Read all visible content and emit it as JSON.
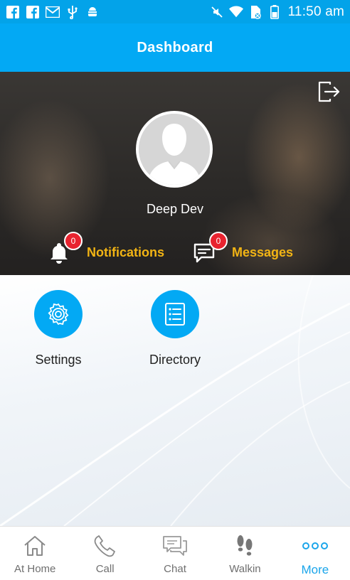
{
  "status_bar": {
    "time": "11:50 am",
    "left_icons": [
      "facebook-icon",
      "facebook-icon",
      "gmail-icon",
      "usb-icon",
      "android-debug-icon"
    ],
    "right_icons": [
      "mute-icon",
      "wifi-icon",
      "no-sim-icon",
      "battery-icon"
    ]
  },
  "app_bar": {
    "title": "Dashboard"
  },
  "profile": {
    "name": "Deep Dev",
    "notifications": {
      "label": "Notifications",
      "count": "0"
    },
    "messages": {
      "label": "Messages",
      "count": "0"
    }
  },
  "tiles": [
    {
      "label": "Settings",
      "icon": "gear-icon"
    },
    {
      "label": "Directory",
      "icon": "list-icon"
    }
  ],
  "bottom_nav": [
    {
      "label": "At Home",
      "icon": "home-icon",
      "active": false
    },
    {
      "label": "Call",
      "icon": "phone-icon",
      "active": false
    },
    {
      "label": "Chat",
      "icon": "chat-icon",
      "active": false
    },
    {
      "label": "Walkin",
      "icon": "footprints-icon",
      "active": false
    },
    {
      "label": "More",
      "icon": "more-dots-icon",
      "active": true
    }
  ],
  "colors": {
    "primary": "#03a9f4",
    "accent_label": "#f2b414",
    "badge": "#e8232f",
    "active_nav": "#1aa5ea"
  }
}
